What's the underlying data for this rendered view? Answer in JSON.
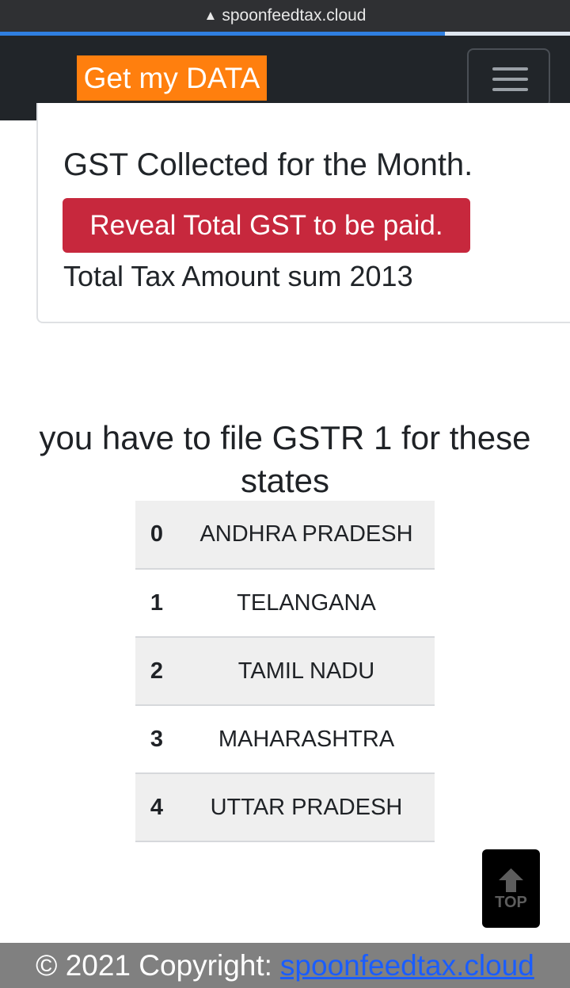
{
  "browser": {
    "warning_icon": "warning-triangle-icon",
    "url": "spoonfeedtax.cloud",
    "load_progress": 0.78
  },
  "navbar": {
    "brand": "Get my DATA",
    "brand_color": "#ff7f0e",
    "menu_icon": "hamburger-menu-icon"
  },
  "card": {
    "title": "GST Collected for the Month.",
    "reveal_button": "Reveal Total GST to be paid.",
    "reveal_color": "#c7283d",
    "total_line": "Total Tax Amount sum 2013"
  },
  "states": {
    "heading": "you have to file GSTR 1 for these states",
    "rows": [
      {
        "index": "0",
        "name": "ANDHRA PRADESH"
      },
      {
        "index": "1",
        "name": "TELANGANA"
      },
      {
        "index": "2",
        "name": "TAMIL NADU"
      },
      {
        "index": "3",
        "name": "MAHARASHTRA"
      },
      {
        "index": "4",
        "name": "UTTAR PRADESH"
      }
    ]
  },
  "back_to_top": {
    "label": "TOP",
    "icon": "arrow-up-icon"
  },
  "footer": {
    "copyright": "© 2021 Copyright:",
    "link": "spoonfeedtax.cloud"
  }
}
